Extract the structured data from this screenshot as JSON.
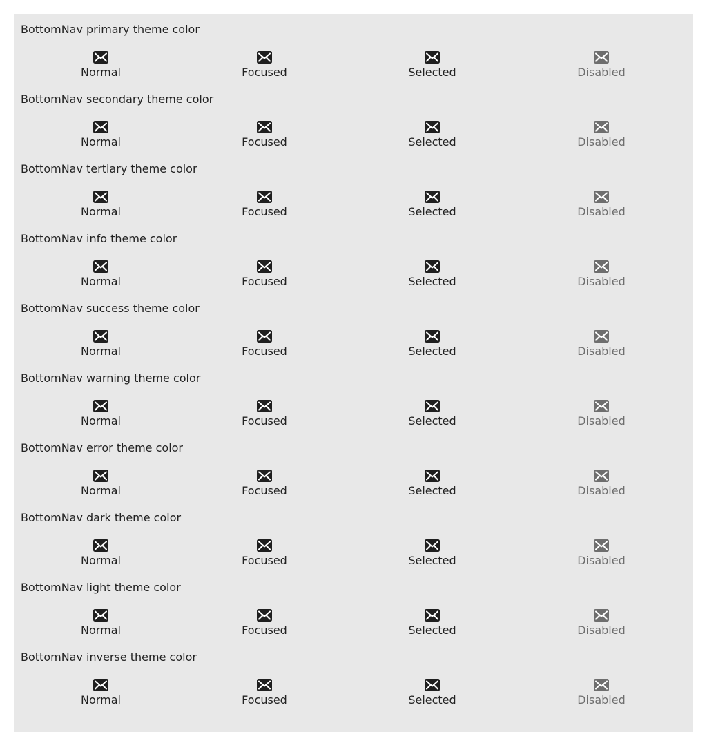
{
  "sections": [
    {
      "title": "BottomNav primary theme color"
    },
    {
      "title": "BottomNav secondary theme color"
    },
    {
      "title": "BottomNav tertiary theme color"
    },
    {
      "title": "BottomNav info theme color"
    },
    {
      "title": "BottomNav success theme color"
    },
    {
      "title": "BottomNav warning theme color"
    },
    {
      "title": "BottomNav error theme color"
    },
    {
      "title": "BottomNav dark theme color"
    },
    {
      "title": "BottomNav light theme color"
    },
    {
      "title": "BottomNav inverse theme color"
    }
  ],
  "items": [
    {
      "label": "Normal",
      "icon": "envelope-icon",
      "state": "normal"
    },
    {
      "label": "Focused",
      "icon": "envelope-icon",
      "state": "focused"
    },
    {
      "label": "Selected",
      "icon": "envelope-icon",
      "state": "selected"
    },
    {
      "label": "Disabled",
      "icon": "envelope-icon",
      "state": "disabled"
    }
  ],
  "colors": {
    "background": "#e8e8e8",
    "text": "#222222",
    "disabled": "#6e6e6e"
  }
}
